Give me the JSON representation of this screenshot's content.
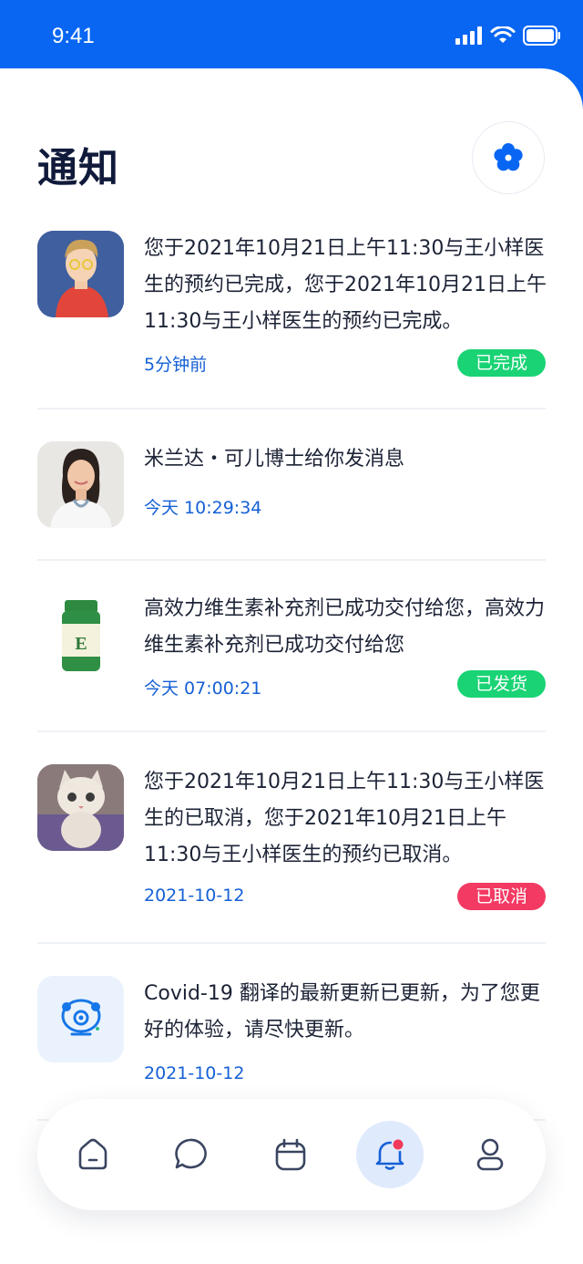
{
  "status_bar": {
    "time": "9:41"
  },
  "header": {
    "title": "通知",
    "settings_icon": "flower-gear-icon"
  },
  "notifications": [
    {
      "message": "您于2021年10月21日上午11:30与王小样医生的预约已完成，您于2021年10月21日上午11:30与王小样医生的预约已完成。",
      "time": "5分钟前",
      "badge": "已完成",
      "badge_color": "#19d374",
      "thumb": "avatar-illustration"
    },
    {
      "message": "米兰达・可儿博士给你发消息",
      "time": "今天 10:29:34",
      "thumb": "doctor-photo"
    },
    {
      "message": "高效力维生素补充剂已成功交付给您，高效力维生素补充剂已成功交付给您",
      "time": "今天 07:00:21",
      "badge": "已发货",
      "badge_color": "#19d374",
      "thumb": "vitamin-bottle"
    },
    {
      "message": "您于2021年10月21日上午11:30与王小样医生的已取消，您于2021年10月21日上午11:30与王小样医生的预约已取消。",
      "time": "2021-10-12",
      "badge": "已取消",
      "badge_color": "#f23a62",
      "thumb": "kitten-photo"
    },
    {
      "message": "Covid-19 翻译的最新更新已更新，为了您更好的体验，请尽快更新。",
      "time": "2021-10-12",
      "thumb": "virus-update-icon"
    }
  ],
  "bottom_nav": {
    "items": [
      "home-icon",
      "chat-icon",
      "calendar-icon",
      "bell-icon",
      "profile-icon"
    ],
    "active_index": 3
  },
  "colors": {
    "primary": "#0866f3",
    "text": "#101a3a",
    "time": "#1560d6"
  }
}
